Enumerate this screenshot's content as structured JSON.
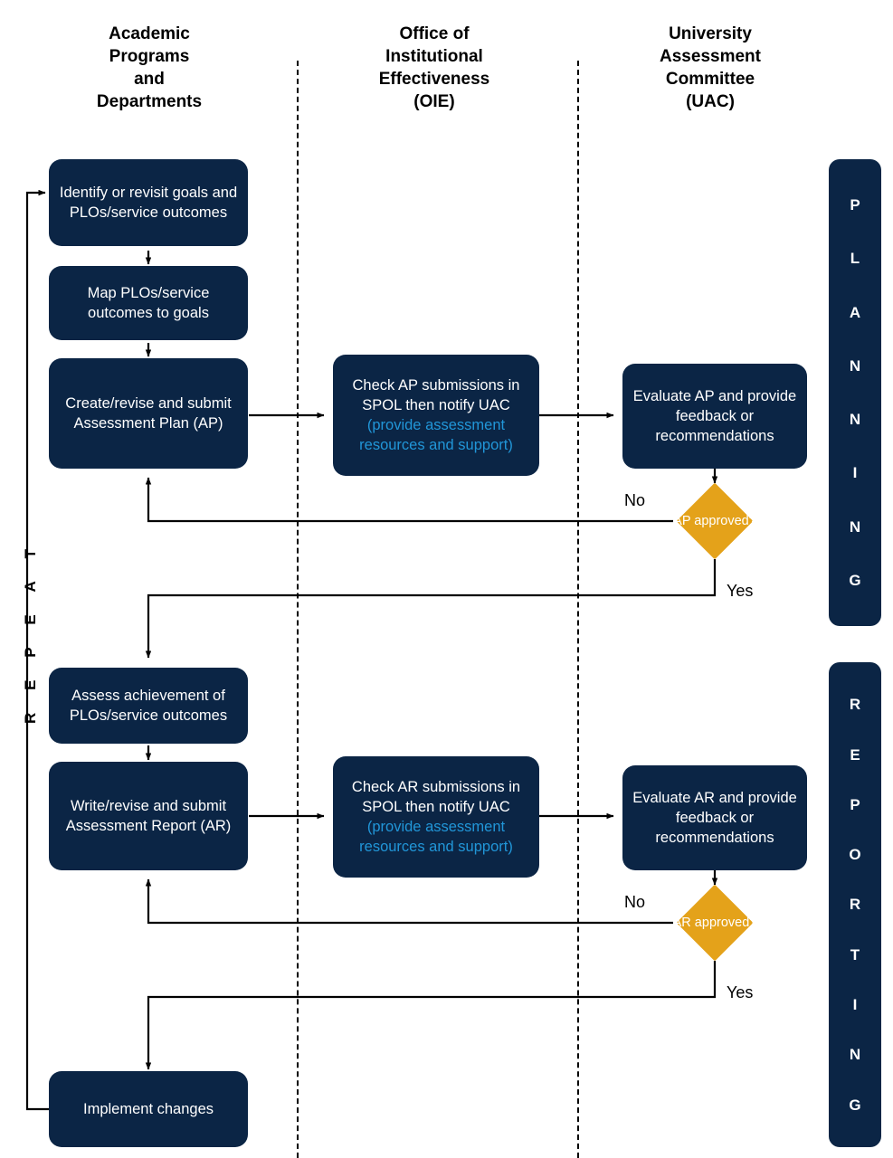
{
  "columns": [
    {
      "id": "academic",
      "label": "Academic\nPrograms\nand\nDepartments"
    },
    {
      "id": "oie",
      "label": "Office of\nInstitutional\nEffectiveness\n(OIE)"
    },
    {
      "id": "uac",
      "label": "University\nAssessment\nCommittee\n(UAC)"
    }
  ],
  "nodes": {
    "identify_goals": "Identify or revisit goals and PLOs/service outcomes",
    "map_plos": "Map PLOs/service outcomes to goals",
    "create_ap": "Create/revise and submit Assessment Plan (AP)",
    "check_ap": "Check AP submissions in SPOL then notify UAC",
    "check_ap_sub": "(provide assessment resources and support)",
    "evaluate_ap": "Evaluate AP and provide feedback or recommendations",
    "assess_achievement": "Assess achievement of PLOs/service outcomes",
    "write_ar": "Write/revise and submit Assessment Report (AR)",
    "check_ar": "Check AR submissions in SPOL then notify UAC",
    "check_ar_sub": "(provide assessment resources and support)",
    "evaluate_ar": "Evaluate AR and provide feedback or recommendations",
    "implement_changes": "Implement changes"
  },
  "decisions": {
    "ap_approved": "AP approved?",
    "ar_approved": "AR approved?"
  },
  "edge_labels": {
    "ap_no": "No",
    "ap_yes": "Yes",
    "ar_no": "No",
    "ar_yes": "Yes"
  },
  "phases": {
    "planning": "PLANNING",
    "reporting": "REPORTING"
  },
  "loop_label": "REPEAT",
  "colors": {
    "node_fill": "#0B2545",
    "node_text": "#FFFFFF",
    "accent_text": "#2196D8",
    "decision_fill": "#E4A21A",
    "line": "#000000",
    "background": "#FFFFFF"
  }
}
